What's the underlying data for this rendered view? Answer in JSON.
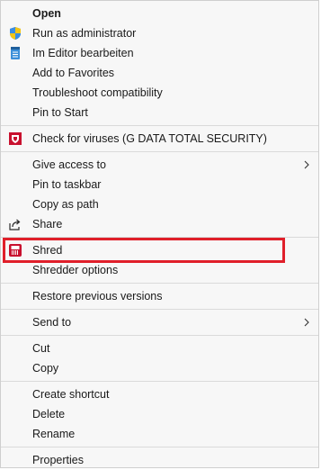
{
  "menu": {
    "open": "Open",
    "run_as_admin": "Run as administrator",
    "open_in_editor": "Im Editor bearbeiten",
    "add_to_favorites": "Add to Favorites",
    "troubleshoot": "Troubleshoot compatibility",
    "pin_to_start": "Pin to Start",
    "check_viruses": "Check for viruses (G DATA TOTAL SECURITY)",
    "give_access": "Give access to",
    "pin_to_taskbar": "Pin to taskbar",
    "copy_as_path": "Copy as path",
    "share": "Share",
    "shred": "Shred",
    "shredder_options": "Shredder options",
    "restore_versions": "Restore previous versions",
    "send_to": "Send to",
    "cut": "Cut",
    "copy": "Copy",
    "create_shortcut": "Create shortcut",
    "delete": "Delete",
    "rename": "Rename",
    "properties": "Properties"
  },
  "icons": {
    "run_as_admin": "uac-shield-icon",
    "open_in_editor": "notepad-icon",
    "check_viruses": "gdata-shield-icon",
    "share": "share-icon",
    "shred": "shredder-icon",
    "submenu": "chevron-right-icon"
  },
  "colors": {
    "highlight_border": "#e01f2a",
    "gdata_red": "#c8102e"
  }
}
